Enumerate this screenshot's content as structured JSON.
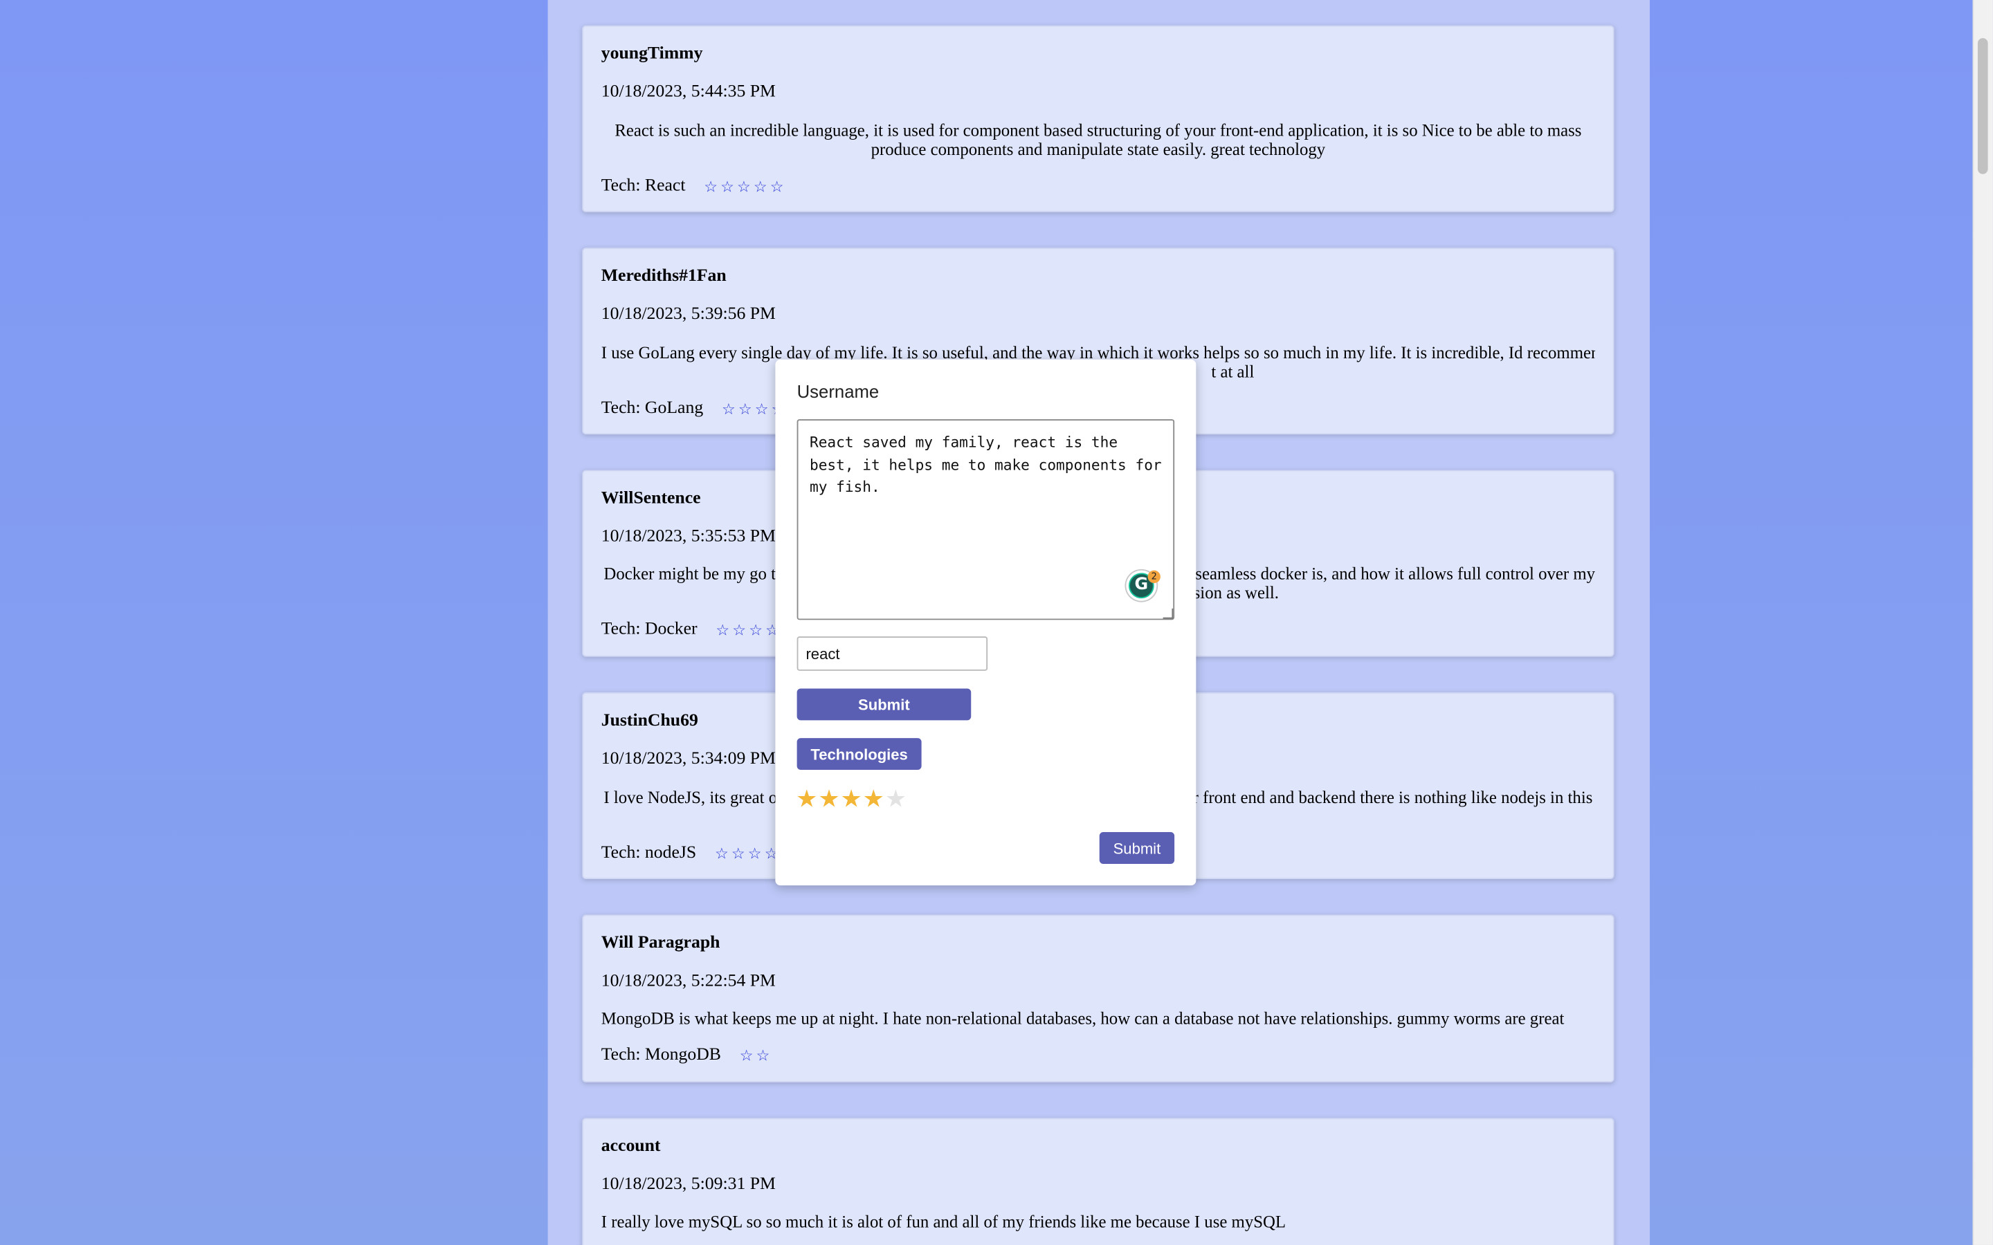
{
  "reviews": [
    {
      "username": "youngTimmy",
      "date": "10/18/2023, 5:44:35 PM",
      "text": "React is such an incredible language, it is used for component based structuring of your front-end application, it is so Nice to be able to mass produce components and manipulate state easily. great technology",
      "tech_label": "Tech: React",
      "stars": [
        "☆",
        "☆",
        "☆",
        "☆",
        "☆"
      ]
    },
    {
      "username": "Merediths#1Fan",
      "date": "10/18/2023, 5:39:56 PM",
      "text": "I use GoLang every single day of my life. It is so useful, and the way in which it works helps so so much in my life. It is incredible, Id recommend to",
      "text_tail": "t at all",
      "tech_label": "Tech: GoLang",
      "stars": [
        "☆",
        "☆",
        "☆",
        "☆"
      ]
    },
    {
      "username": "WillSentence",
      "date": "10/18/2023, 5:35:53 PM",
      "text_left": "Docker might be my go to",
      "text_right": "v seamless docker is, and how it allows full control over my",
      "text_tail": "sion as well.",
      "tech_label": "Tech: Docker",
      "stars": [
        "☆",
        "☆",
        "☆",
        "☆"
      ]
    },
    {
      "username": "JustinChu69",
      "date": "10/18/2023, 5:34:09 PM",
      "text_left": "I love NodeJS, its great or",
      "text_right": "ur front end and backend there is nothing like nodejs in this",
      "tech_label": "Tech: nodeJS",
      "stars": [
        "☆",
        "☆",
        "☆",
        "☆"
      ]
    },
    {
      "username": "Will Paragraph",
      "date": "10/18/2023, 5:22:54 PM",
      "text": "MongoDB is what keeps me up at night. I hate non-relational databases, how can a database not have relationships. gummy worms are great",
      "tech_label": "Tech: MongoDB",
      "stars": [
        "☆",
        "☆"
      ]
    },
    {
      "username": "account",
      "date": "10/18/2023, 5:09:31 PM",
      "text": "I really love mySQL so so much it is alot of fun and all of my friends like me because I use mySQL"
    }
  ],
  "modal": {
    "title": "Username",
    "review_text": "React saved my family, react is the best, it helps me to make components for my fish.",
    "grammar_icon_letter": "G",
    "grammar_count": "2",
    "tech_input_value": "react",
    "submit_tech_label": "Submit",
    "technologies_label": "Technologies",
    "rating": 4,
    "rating_max": 5,
    "rating_glyph": "★",
    "submit_review_label": "Submit"
  }
}
